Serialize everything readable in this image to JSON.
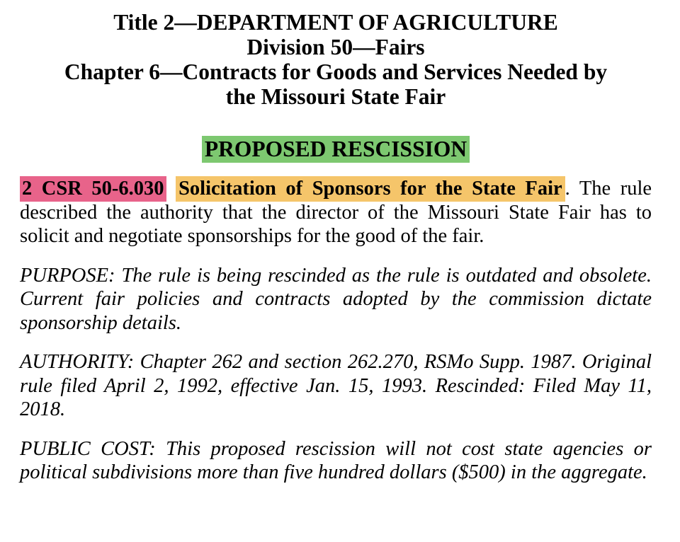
{
  "header": {
    "title_line": "Title 2—DEPARTMENT OF AGRICULTURE",
    "division_line": "Division 50—Fairs",
    "chapter_line_1": "Chapter 6—Contracts for Goods and Services Needed by",
    "chapter_line_2": "the Missouri State Fair"
  },
  "proposed_label": "PROPOSED RESCISSION",
  "rule": {
    "id": "2 CSR 50-6.030",
    "title": "Solicitation of Sponsors for the State Fair",
    "description": ". The rule described the authority that the director of the Missouri State Fair has to solicit and negotiate sponsorships for the good of the fair."
  },
  "purpose": "PURPOSE: The rule is being rescinded as the rule is outdated and obsolete. Current fair policies and contracts adopted by the commis­sion dictate sponsorship details.",
  "authority": "AUTHORITY: Chapter 262 and section 262.270, RSMo Supp. 1987. Original rule filed April 2, 1992, effective Jan. 15, 1993. Rescinded: Filed May 11, 2018.",
  "public_cost": "PUBLIC COST: This proposed rescission will not cost state agencies or political subdivisions more than five hundred dollars ($500) in the aggregate.",
  "colors": {
    "proposed_highlight": "#7dc870",
    "rule_id_highlight": "#e8638a",
    "rule_title_highlight": "#f5c56a"
  }
}
